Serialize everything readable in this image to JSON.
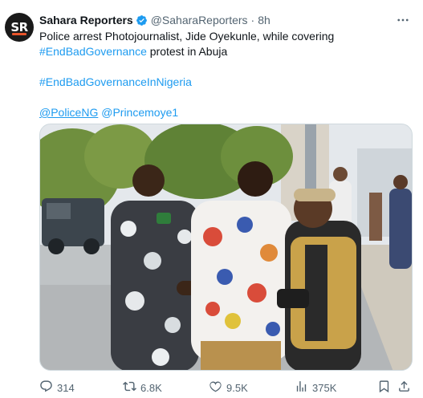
{
  "author": {
    "avatar_text": "SR",
    "name": "Sahara Reporters",
    "handle": "@SaharaReporters",
    "separator": "·",
    "time": "8h",
    "verified_icon": "verified-badge-icon"
  },
  "tweet": {
    "line1": "Police arrest Photojournalist, Jide Oyekunle, while covering",
    "hashtag1": "#EndBadGovernance",
    "line2_rest": " protest in Abuja",
    "hashtag2": "#EndBadGovernanceInNigeria",
    "mention1": "@PoliceNG",
    "mention2": "@Princemoye1"
  },
  "media": {
    "description_icon": "photo"
  },
  "actions": {
    "replies": "314",
    "retweets": "6.8K",
    "likes": "9.5K",
    "views": "375K"
  },
  "colors": {
    "link": "#1d9bf0",
    "secondary_text": "#536471",
    "primary_text": "#0f1419",
    "avatar_accent": "#e8542a"
  }
}
